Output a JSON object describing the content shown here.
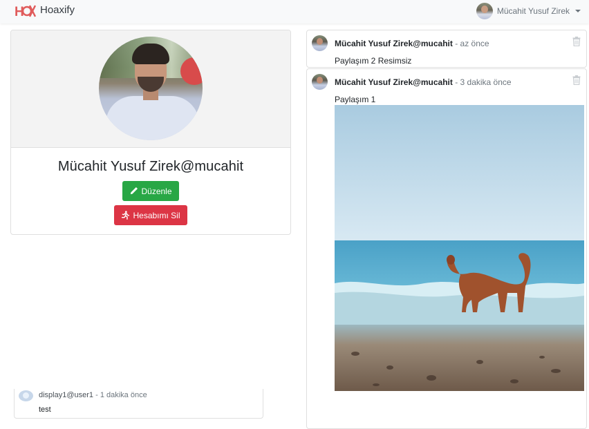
{
  "navbar": {
    "brand": "Hoaxify",
    "logo_icon": "hoaxify-logo-icon",
    "user_name": "Mücahit Yusuf Zirek"
  },
  "profile": {
    "title": "Mücahit Yusuf Zirek@mucahit",
    "edit_label": "Düzenle",
    "delete_label": "Hesabımı Sil",
    "edit_color": "#28a745",
    "delete_color": "#dc3545"
  },
  "feed": [
    {
      "author": "Mücahit Yusuf Zirek@mucahit",
      "time": " - az önce",
      "text": "Paylaşım 2 Resimsiz"
    },
    {
      "author": "Mücahit Yusuf Zirek@mucahit",
      "time": " - 3 dakika önce",
      "text": "Paylaşım 1",
      "image": "dog-on-beach-photo"
    }
  ],
  "bottom_post": {
    "author": "display1@user1",
    "time": " - 1 dakika önce",
    "text": "test"
  }
}
